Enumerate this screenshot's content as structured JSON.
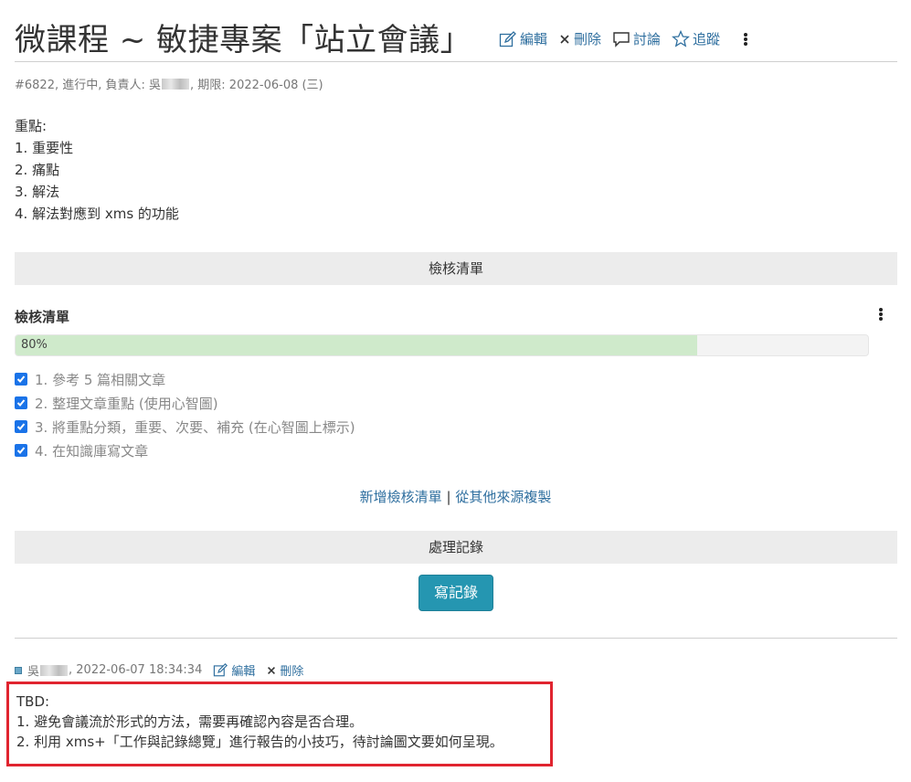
{
  "header": {
    "title": "微課程 ~ 敏捷專案「站立會議」",
    "actions": {
      "edit": "編輯",
      "delete": "刪除",
      "discuss": "討論",
      "follow": "追蹤"
    }
  },
  "meta": {
    "prefix": "#6822, 進行中, 負責人: 吳",
    "suffix": ", 期限: 2022-06-08 (三)"
  },
  "description": {
    "heading": "重點:",
    "items": [
      "1. 重要性",
      "2. 痛點",
      "3. 解法",
      "4. 解法對應到 xms 的功能"
    ]
  },
  "checklist_section": {
    "bar_label": "檢核清單",
    "title": "檢核清單",
    "progress_percent": 80,
    "progress_label": "80%",
    "items": [
      {
        "label": "1. 參考 5 篇相關文章",
        "checked": true
      },
      {
        "label": "2. 整理文章重點 (使用心智圖)",
        "checked": true
      },
      {
        "label": "3. 將重點分類，重要、次要、補充 (在心智圖上標示)",
        "checked": true
      },
      {
        "label": "4. 在知識庫寫文章",
        "checked": true
      }
    ],
    "add_link": "新增檢核清單",
    "separator": "|",
    "copy_link": "從其他來源複製"
  },
  "records_section": {
    "bar_label": "處理記錄",
    "write_button": "寫記錄"
  },
  "comment": {
    "author_prefix": "吳",
    "timestamp": ", 2022-06-07 18:34:34",
    "edit": "編輯",
    "delete": "刪除",
    "lines": [
      "TBD:",
      "1. 避免會議流於形式的方法，需要再確認內容是否合理。",
      "2. 利用 xms+「工作與記錄總覽」進行報告的小技巧，待討論圖文要如何呈現。"
    ]
  },
  "colors": {
    "link": "#2f6f9f",
    "progress_fill": "#cfeacb",
    "button": "#2596b1",
    "highlight_border": "#e0242f",
    "checkbox": "#1a73e8"
  }
}
